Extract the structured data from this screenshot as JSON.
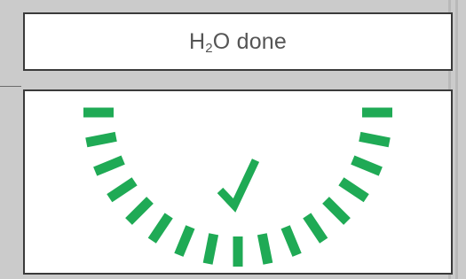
{
  "status": {
    "formula_main": "H",
    "formula_sub": "2",
    "formula_rest": "O",
    "word": "done"
  },
  "indicator": {
    "check_glyph": "✓",
    "check_icon": "checkmark-icon",
    "segment_count": 17,
    "progress_fraction": 1.0,
    "color": "#1faa55"
  }
}
